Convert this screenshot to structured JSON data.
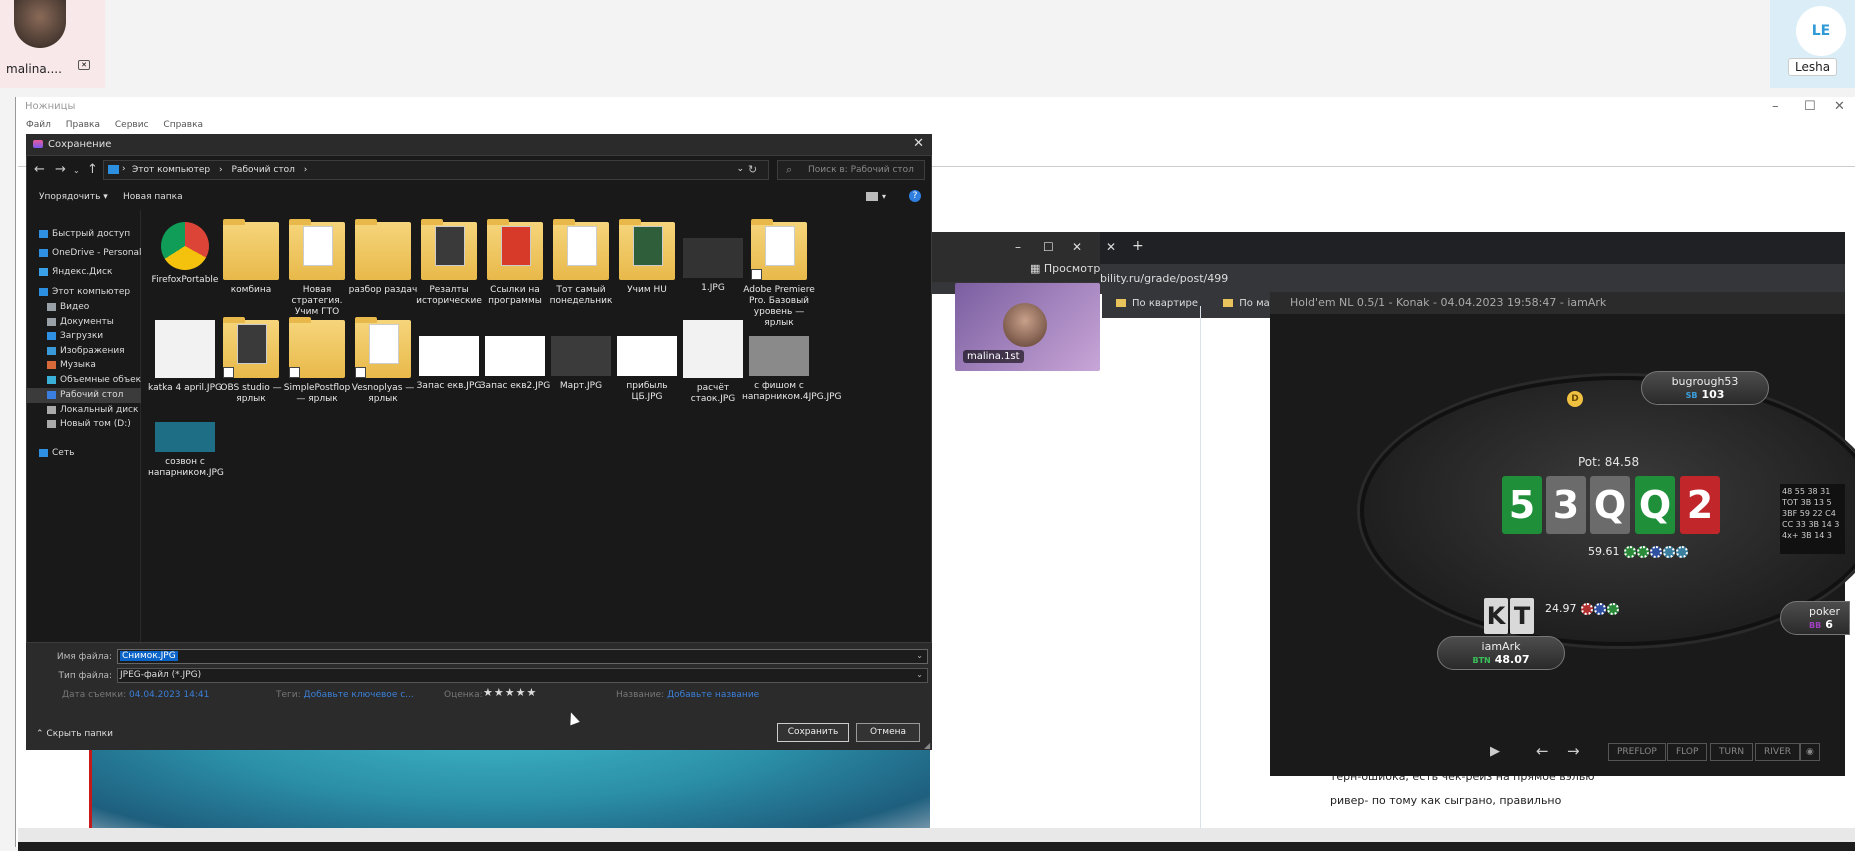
{
  "call": {
    "left_name": "malina....",
    "right_initials": "LE",
    "right_name": "Lesha"
  },
  "snip": {
    "title": "Ножницы",
    "menu": [
      "Файл",
      "Правка",
      "Сервис",
      "Справка"
    ]
  },
  "browser": {
    "url": "bility.ru/grade/post/499",
    "preview_label": "Просмотр",
    "bookmarks": [
      "По квартире",
      "По машине"
    ],
    "small_video_name": "malina.1st",
    "page_text": [
      "терн-ошибка, есть чек-рейз на прямое вэлью",
      "ривер- по тому как сыграно, правильно"
    ]
  },
  "poker": {
    "title": "Hold'em NL 0.5/1 - Konak - 04.04.2023 19:58:47 - iamArk",
    "pot_label": "Pot:",
    "pot_value": "84.58",
    "board": [
      {
        "rank": "5",
        "color": "#1f8f3a"
      },
      {
        "rank": "3",
        "color": "#6b6b6b"
      },
      {
        "rank": "Q",
        "color": "#6b6b6b"
      },
      {
        "rank": "Q",
        "color": "#1f8f3a"
      },
      {
        "rank": "2",
        "color": "#c0262a"
      }
    ],
    "bet_top": "59.61",
    "bet_hero": "24.97",
    "hero_cards": [
      "K",
      "T"
    ],
    "seats": {
      "top": {
        "name": "bugrough53",
        "tag": "SB",
        "stack": "103"
      },
      "hero": {
        "name": "iamArk",
        "tag": "BTN",
        "stack": "48.07"
      },
      "right": {
        "name": "poker",
        "tag": "BB",
        "stack": "6"
      }
    },
    "dealer": "D",
    "streets": [
      "PREFLOP",
      "FLOP",
      "TURN",
      "RIVER"
    ],
    "hud": [
      "48 55 38 31",
      "TOT 3B 13 5",
      "3BF 59 22 C4",
      "CC 33 3B 14 3",
      "4x+ 3B 14 3"
    ]
  },
  "dialog": {
    "title": "Сохранение",
    "breadcrumb": [
      "Этот компьютер",
      "Рабочий стол"
    ],
    "search_placeholder": "Поиск в: Рабочий стол",
    "organize": "Упорядочить ▾",
    "new_folder": "Новая папка",
    "tree": [
      {
        "label": "Быстрый доступ",
        "icon": "star-icon",
        "color": "#2f8fe0"
      },
      {
        "label": "OneDrive - Personal",
        "icon": "cloud-icon",
        "color": "#2f8fe0"
      },
      {
        "label": "Яндекс.Диск",
        "icon": "yadisk-icon",
        "color": "#3aa0e8"
      },
      {
        "label": "Этот компьютер",
        "icon": "computer-icon",
        "color": "#2d8fe0"
      },
      {
        "label": "Видео",
        "icon": "video-icon",
        "color": "#9aa0a8"
      },
      {
        "label": "Документы",
        "icon": "document-icon",
        "color": "#9aa0a8"
      },
      {
        "label": "Загрузки",
        "icon": "download-icon",
        "color": "#2f8fe0"
      },
      {
        "label": "Изображения",
        "icon": "image-icon",
        "color": "#3a9ad9"
      },
      {
        "label": "Музыка",
        "icon": "music-icon",
        "color": "#d86a3a"
      },
      {
        "label": "Объемные объекты",
        "icon": "3d-icon",
        "color": "#3ab0d9"
      },
      {
        "label": "Рабочий стол",
        "icon": "desktop-icon",
        "color": "#3a7fe0"
      },
      {
        "label": "Локальный диск (C:)",
        "icon": "drive-icon",
        "color": "#aaaaaa"
      },
      {
        "label": "Новый том (D:)",
        "icon": "drive-icon",
        "color": "#aaaaaa"
      },
      {
        "label": "Сеть",
        "icon": "network-icon",
        "color": "#2f8fe0"
      }
    ],
    "files": [
      {
        "label": "FirefoxPortable",
        "kind": "chrome"
      },
      {
        "label": "комбина",
        "kind": "folder"
      },
      {
        "label": "Новая стратегия. Учим ГТО",
        "kind": "folder-doc"
      },
      {
        "label": "разбор раздач",
        "kind": "folder"
      },
      {
        "label": "Резалты исторические",
        "kind": "folder-dark"
      },
      {
        "label": "Ссылки на программы",
        "kind": "folder-pdf"
      },
      {
        "label": "Тот самый понедельник",
        "kind": "folder-doc"
      },
      {
        "label": "Учим HU",
        "kind": "folder-green"
      },
      {
        "label": "1.JPG",
        "kind": "image-dark"
      },
      {
        "label": "Adobe Premiere Pro. Базовый уровень — ярлык",
        "kind": "folder-doc"
      },
      {
        "label": "katka 4 april.JPG",
        "kind": "image-sheet"
      },
      {
        "label": "OBS studio — ярлык",
        "kind": "folder-dark"
      },
      {
        "label": "SimplePostflop — ярлык",
        "kind": "folder"
      },
      {
        "label": "Vesnoplyas — ярлык",
        "kind": "folder-doc"
      },
      {
        "label": "Запас екв.JPG",
        "kind": "image-white"
      },
      {
        "label": "Запас екв2.JPG",
        "kind": "image-white"
      },
      {
        "label": "Март.JPG",
        "kind": "image-chart"
      },
      {
        "label": "прибыль ЦБ.JPG",
        "kind": "image-white"
      },
      {
        "label": "расчёт стаок.JPG",
        "kind": "image-sheet"
      },
      {
        "label": "с фишом с напарником.4JPG.JPG",
        "kind": "image-mixed"
      },
      {
        "label": "созвон с напарником.JPG",
        "kind": "image-teal"
      }
    ],
    "filename_label": "Имя файла:",
    "filename_value": "Снимок.JPG",
    "filetype_label": "Тип файла:",
    "filetype_value": "JPEG-файл (*.JPG)",
    "meta": {
      "date_label": "Дата съемки:",
      "date_value": "04.04.2023 14:41",
      "tags_label": "Теги:",
      "tags_value": "Добавьте ключевое с...",
      "rating_label": "Оценка:",
      "rating_value": "★★★★★",
      "name_label": "Название:",
      "name_value": "Добавьте название"
    },
    "hide_folders": "Скрыть папки",
    "save": "Сохранить",
    "cancel": "Отмена"
  }
}
